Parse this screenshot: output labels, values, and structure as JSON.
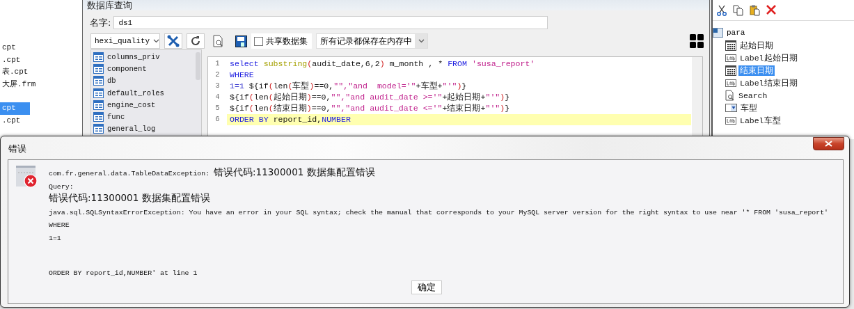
{
  "file_list": [
    {
      "name": "cpt",
      "selected": false
    },
    {
      "name": ".cpt",
      "selected": false
    },
    {
      "name": "表.cpt",
      "selected": false
    },
    {
      "name": "大屏.frm",
      "selected": false
    },
    {
      "name": "cpt",
      "selected": true
    },
    {
      "name": ".cpt",
      "selected": false
    }
  ],
  "query_dialog": {
    "title": "数据库查询",
    "name_label": "名字:",
    "name_value": "ds1",
    "database": "hexi_quality",
    "share_dataset": {
      "label": "共享数据集",
      "checked": false
    },
    "storage_mode": "所有记录都保存在内存中",
    "tables": [
      "columns_priv",
      "component",
      "db",
      "default_roles",
      "engine_cost",
      "func",
      "general_log"
    ],
    "code_lines": [
      {
        "number": "1",
        "highlighted": false,
        "tokens": [
          {
            "kind": "keyword",
            "text": "select"
          },
          {
            "kind": "function",
            "text": " substring"
          },
          {
            "kind": "paren",
            "text": "("
          },
          {
            "kind": "plain",
            "text": "audit_date,6,2"
          },
          {
            "kind": "paren",
            "text": ")"
          },
          {
            "kind": "plain",
            "text": " m_month , * "
          },
          {
            "kind": "keyword",
            "text": "FROM"
          },
          {
            "kind": "string",
            "text": " 'susa_report'"
          }
        ]
      },
      {
        "number": "2",
        "highlighted": false,
        "tokens": [
          {
            "kind": "keyword",
            "text": "WHERE"
          }
        ]
      },
      {
        "number": "3",
        "highlighted": false,
        "tokens": [
          {
            "kind": "number",
            "text": "1=1"
          },
          {
            "kind": "plain",
            "text": " ${if"
          },
          {
            "kind": "paren",
            "text": "("
          },
          {
            "kind": "plain",
            "text": "len"
          },
          {
            "kind": "paren",
            "text": "("
          },
          {
            "kind": "plain",
            "text": "车型"
          },
          {
            "kind": "paren",
            "text": ")"
          },
          {
            "kind": "plain",
            "text": "==0,"
          },
          {
            "kind": "string",
            "text": "\"\",\"and  model='\""
          },
          {
            "kind": "plain",
            "text": "+车型+"
          },
          {
            "kind": "string",
            "text": "\"'\""
          },
          {
            "kind": "paren",
            "text": ")"
          },
          {
            "kind": "plain",
            "text": "}"
          }
        ]
      },
      {
        "number": "4",
        "highlighted": false,
        "tokens": [
          {
            "kind": "plain",
            "text": "${if"
          },
          {
            "kind": "paren",
            "text": "("
          },
          {
            "kind": "plain",
            "text": "len"
          },
          {
            "kind": "paren",
            "text": "("
          },
          {
            "kind": "plain",
            "text": "起始日期"
          },
          {
            "kind": "paren",
            "text": ")"
          },
          {
            "kind": "plain",
            "text": "==0,"
          },
          {
            "kind": "string",
            "text": "\"\",\"and audit_date >='\""
          },
          {
            "kind": "plain",
            "text": "+起始日期+"
          },
          {
            "kind": "string",
            "text": "\"'\""
          },
          {
            "kind": "paren",
            "text": ")"
          },
          {
            "kind": "plain",
            "text": "}"
          }
        ]
      },
      {
        "number": "5",
        "highlighted": false,
        "tokens": [
          {
            "kind": "plain",
            "text": "${if"
          },
          {
            "kind": "paren",
            "text": "("
          },
          {
            "kind": "plain",
            "text": "len"
          },
          {
            "kind": "paren",
            "text": "("
          },
          {
            "kind": "plain",
            "text": "结束日期"
          },
          {
            "kind": "paren",
            "text": ")"
          },
          {
            "kind": "plain",
            "text": "==0,"
          },
          {
            "kind": "string",
            "text": "\"\",\"and audit_date <='\""
          },
          {
            "kind": "plain",
            "text": "+结束日期+"
          },
          {
            "kind": "string",
            "text": "\"'\""
          },
          {
            "kind": "paren",
            "text": ")"
          },
          {
            "kind": "plain",
            "text": "}"
          }
        ]
      },
      {
        "number": "6",
        "highlighted": true,
        "tokens": [
          {
            "kind": "keyword",
            "text": "ORDER BY"
          },
          {
            "kind": "plain",
            "text": " report_id,"
          },
          {
            "kind": "keyword",
            "text": "NUMBER"
          }
        ]
      }
    ]
  },
  "widget_tree": {
    "root": "para",
    "children": [
      {
        "name": "起始日期",
        "kind": "date",
        "selected": false
      },
      {
        "name": "Label起始日期",
        "kind": "label",
        "selected": false
      },
      {
        "name": "结束日期",
        "kind": "date",
        "selected": true
      },
      {
        "name": "Label结束日期",
        "kind": "label",
        "selected": false
      },
      {
        "name": "Search",
        "kind": "search",
        "selected": false
      },
      {
        "name": "车型",
        "kind": "combo",
        "selected": false
      },
      {
        "name": "Label车型",
        "kind": "label",
        "selected": false
      }
    ]
  },
  "error_dialog": {
    "title": "错误",
    "lines": [
      {
        "parts": [
          {
            "kind": "mono",
            "text": "com.fr.general.data.TableDataException: "
          },
          {
            "kind": "cjk",
            "text": "错误代码:11300001 数据集配置错误"
          }
        ]
      },
      {
        "parts": [
          {
            "kind": "mono",
            "text": "Query:"
          }
        ]
      },
      {
        "parts": [
          {
            "kind": "cjk",
            "text": "错误代码:11300001 数据集配置错误"
          }
        ]
      },
      {
        "parts": [
          {
            "kind": "mono",
            "text": "java.sql.SQLSyntaxErrorException: You have an error in your SQL syntax; check the manual that corresponds to your MySQL server version for the right syntax to use near '* FROM 'susa_report'"
          }
        ]
      },
      {
        "parts": [
          {
            "kind": "mono",
            "text": "WHERE"
          }
        ]
      },
      {
        "parts": [
          {
            "kind": "mono",
            "text": "1=1"
          }
        ]
      },
      {
        "parts": [
          {
            "kind": "mono",
            "text": "ORDER BY report_id,NUMBER' at line 1"
          }
        ]
      }
    ],
    "ok_button": "确定"
  }
}
